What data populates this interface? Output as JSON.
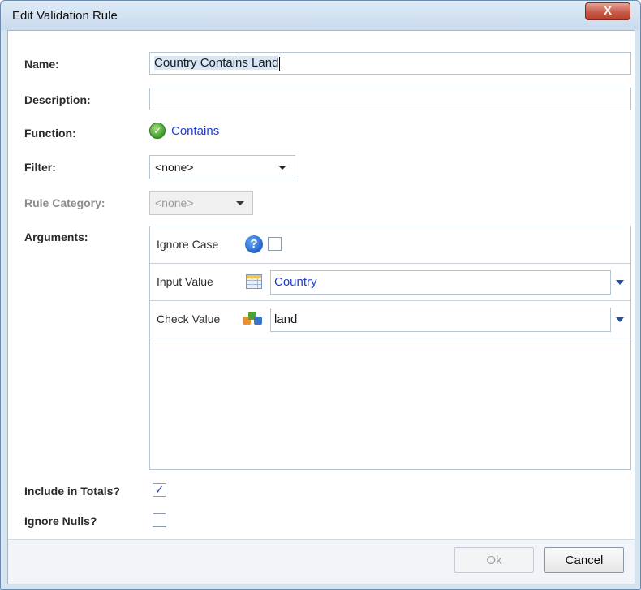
{
  "window": {
    "title": "Edit Validation Rule",
    "close_label": "X"
  },
  "form": {
    "name_label": "Name:",
    "name_value": "Country Contains Land",
    "description_label": "Description:",
    "description_value": "",
    "function_label": "Function:",
    "function_value": "Contains",
    "filter_label": "Filter:",
    "filter_value": "<none>",
    "rule_category_label": "Rule Category:",
    "rule_category_value": "<none>",
    "arguments_label": "Arguments:",
    "include_totals_label": "Include in Totals?",
    "include_totals_checked": true,
    "ignore_nulls_label": "Ignore Nulls?",
    "ignore_nulls_checked": false
  },
  "arguments": {
    "ignore_case_label": "Ignore Case",
    "ignore_case_checked": false,
    "input_value_label": "Input Value",
    "input_value": "Country",
    "check_value_label": "Check Value",
    "check_value": "land"
  },
  "buttons": {
    "ok": "Ok",
    "cancel": "Cancel"
  },
  "icons": {
    "function": "check-circle-icon",
    "help": "help-icon",
    "input_value": "table-icon",
    "check_value": "cubes-icon"
  },
  "colors": {
    "link": "#1f3fd1",
    "accent": "#1b4fa8",
    "close": "#c75a48"
  }
}
